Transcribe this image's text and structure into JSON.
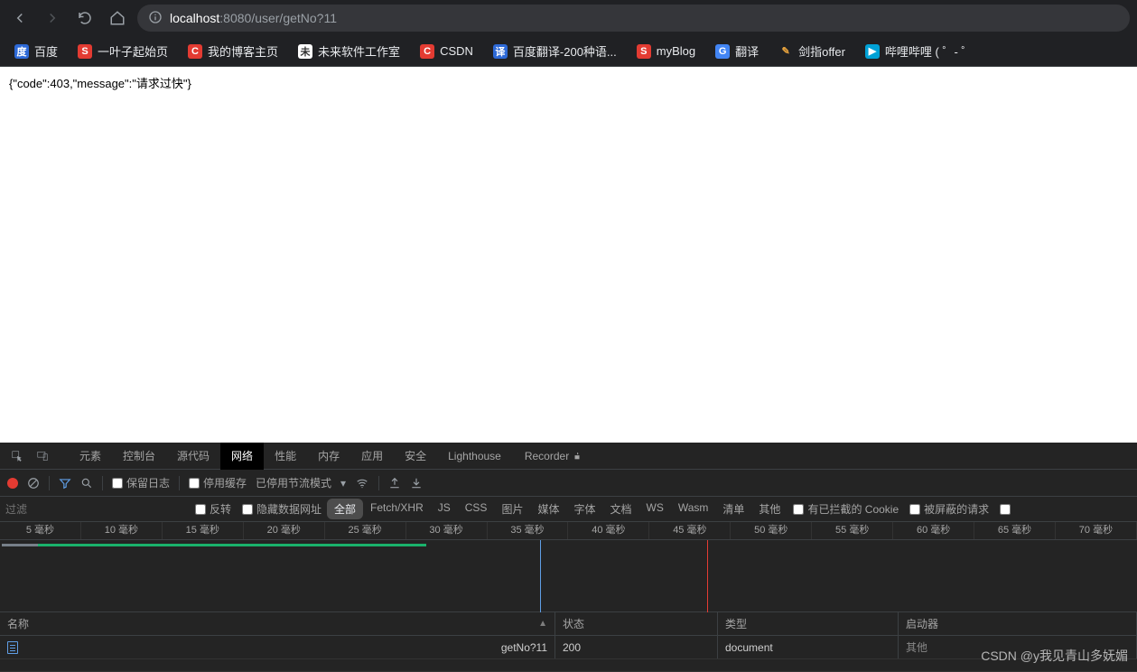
{
  "browser": {
    "url_host": "localhost",
    "url_port": ":8080",
    "url_path": "/user/getNo?11"
  },
  "bookmarks": [
    {
      "label": "百度",
      "bg": "#2d69d7",
      "fg": "#fff",
      "icon": "度"
    },
    {
      "label": "一叶子起始页",
      "bg": "#e33b32",
      "fg": "#fff",
      "icon": "S"
    },
    {
      "label": "我的博客主页",
      "bg": "#e33b32",
      "fg": "#fff",
      "icon": "C"
    },
    {
      "label": "未来软件工作室",
      "bg": "#ffffff",
      "fg": "#333",
      "icon": "未"
    },
    {
      "label": "CSDN",
      "bg": "#e33b32",
      "fg": "#fff",
      "icon": "C"
    },
    {
      "label": "百度翻译-200种语...",
      "bg": "#2d69d7",
      "fg": "#fff",
      "icon": "译"
    },
    {
      "label": "myBlog",
      "bg": "#e33b32",
      "fg": "#fff",
      "icon": "S"
    },
    {
      "label": "翻译",
      "bg": "#4285f4",
      "fg": "#fff",
      "icon": "G"
    },
    {
      "label": "剑指offer",
      "bg": "transparent",
      "fg": "#e8a33d",
      "icon": "✎"
    },
    {
      "label": "哔哩哔哩 (  ゜-  ゜",
      "bg": "#00a1d6",
      "fg": "#fff",
      "icon": "▶"
    }
  ],
  "page": {
    "body": "{\"code\":403,\"message\":\"请求过快\"}"
  },
  "devtools": {
    "tabs": [
      "元素",
      "控制台",
      "源代码",
      "网络",
      "性能",
      "内存",
      "应用",
      "安全",
      "Lighthouse"
    ],
    "recorder": "Recorder",
    "active_tab": "网络",
    "toolbar": {
      "preserve_log": "保留日志",
      "disable_cache": "停用缓存",
      "throttling": "已停用节流模式"
    },
    "filter": {
      "placeholder": "过滤",
      "invert": "反转",
      "hide_data": "隐藏数据网址",
      "types": [
        "全部",
        "Fetch/XHR",
        "JS",
        "CSS",
        "图片",
        "媒体",
        "字体",
        "文档",
        "WS",
        "Wasm",
        "清单",
        "其他"
      ],
      "blocked_cookies": "有已拦截的 Cookie",
      "blocked_req": "被屏蔽的请求"
    },
    "timeline_ticks": [
      "5 毫秒",
      "10 毫秒",
      "15 毫秒",
      "20 毫秒",
      "25 毫秒",
      "30 毫秒",
      "35 毫秒",
      "40 毫秒",
      "45 毫秒",
      "50 毫秒",
      "55 毫秒",
      "60 毫秒",
      "65 毫秒",
      "70 毫秒"
    ],
    "columns": {
      "name": "名称",
      "status": "状态",
      "type": "类型",
      "initiator": "启动器"
    },
    "request": {
      "name": "getNo?11",
      "status": "200",
      "type": "document",
      "initiator": "其他"
    }
  },
  "watermark": "CSDN @y我见青山多妩媚"
}
